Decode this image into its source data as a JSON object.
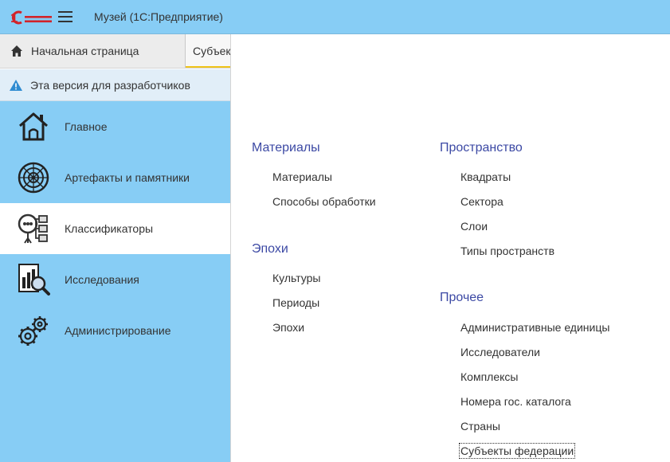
{
  "window": {
    "title": "Музей  (1С:Предприятие)",
    "logo_text": "1С"
  },
  "tabs": {
    "home_label": "Начальная страница",
    "current_label": "Субъекты федерации"
  },
  "warning": {
    "text": "Эта версия для разработчиков"
  },
  "sidebar": {
    "items": [
      {
        "label": "Главное",
        "icon": "house-icon"
      },
      {
        "label": "Артефакты и памятники",
        "icon": "artifacts-icon"
      },
      {
        "label": "Классификаторы",
        "icon": "classifiers-icon",
        "active": true
      },
      {
        "label": "Исследования",
        "icon": "research-icon"
      },
      {
        "label": "Администрирование",
        "icon": "gears-icon"
      }
    ]
  },
  "menu": {
    "groups": [
      {
        "title": "Материалы",
        "items": [
          "Материалы",
          "Способы обработки"
        ]
      },
      {
        "title": "Эпохи",
        "items": [
          "Культуры",
          "Периоды",
          "Эпохи"
        ]
      },
      {
        "title": "Пространство",
        "items": [
          "Квадраты",
          "Сектора",
          "Слои",
          "Типы пространств"
        ]
      },
      {
        "title": "Прочее",
        "items": [
          "Административные единицы",
          "Исследователи",
          "Комплексы",
          "Номера гос. каталога",
          "Страны",
          "Субъекты федерации"
        ]
      }
    ],
    "focused_item": "Субъекты федерации"
  },
  "colors": {
    "accent": "#87cdf5",
    "group_title": "#3c49a4",
    "logo_red": "#d2232a",
    "tab_underline": "#f0c419"
  }
}
